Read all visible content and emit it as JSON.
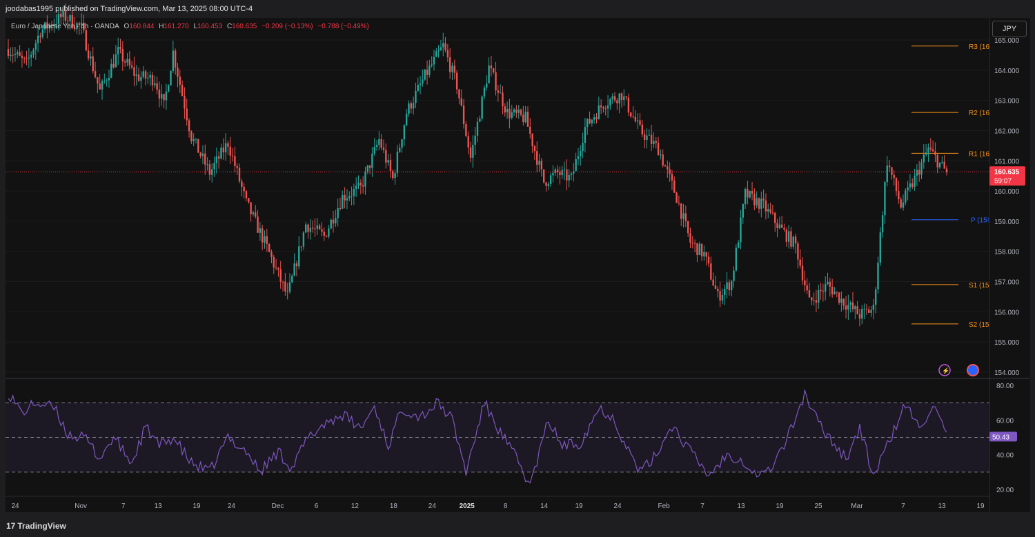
{
  "header": {
    "publisher": "joodabas1995 published on TradingView.com, Mar 13, 2025 08:00 UTC-4"
  },
  "legend": {
    "symbol": "Euro / Japanese Yen · 4h · OANDA",
    "open_k": "O",
    "open": "160.844",
    "high_k": "H",
    "high": "161.270",
    "low_k": "L",
    "low": "160.453",
    "close_k": "C",
    "close": "160.635",
    "change": "−0.209 (−0.13%)",
    "change2": "−0.788 (−0.49%)"
  },
  "currency_button": "JPY",
  "footer": {
    "brand": "TradingView",
    "logo_icon": "tradingview-logo-icon"
  },
  "colors": {
    "up": "#26a69a",
    "down": "#ef5350",
    "rsi": "#7e57c2",
    "pivot_resistance": "#f7931a",
    "pivot_p": "#2962ff",
    "price_label": "#f23645"
  },
  "chart_data": [
    {
      "type": "candlestick",
      "title": "Euro / Japanese Yen · 4h · OANDA",
      "ylim": [
        153.8,
        165.2
      ],
      "y_ticks": [
        "165.000",
        "164.000",
        "163.000",
        "162.000",
        "161.000",
        "160.000",
        "159.000",
        "158.000",
        "157.000",
        "156.000",
        "155.000",
        "154.000"
      ],
      "x_ticks": [
        "24",
        "Nov",
        "7",
        "13",
        "19",
        "24",
        "Dec",
        "6",
        "12",
        "18",
        "24",
        "2025",
        "8",
        "14",
        "19",
        "24",
        "Feb",
        "7",
        "13",
        "19",
        "25",
        "Mar",
        "7",
        "13",
        "19"
      ],
      "last_price": "160.635",
      "countdown": "59:07",
      "pivot_levels": [
        {
          "name": "R3",
          "label": "R3 (16",
          "value": 164.8
        },
        {
          "name": "R2",
          "label": "R2 (16",
          "value": 162.6
        },
        {
          "name": "R1",
          "label": "R1 (16",
          "value": 161.25
        },
        {
          "name": "P",
          "label": "P (15!",
          "value": 159.05
        },
        {
          "name": "S1",
          "label": "S1 (15",
          "value": 156.9
        },
        {
          "name": "S2",
          "label": "S2 (15",
          "value": 155.6
        }
      ],
      "series": [
        {
          "name": "EURJPY",
          "anchors": [
            [
              0,
              164.7
            ],
            [
              8,
              164.2
            ],
            [
              14,
              165.3
            ],
            [
              24,
              165.8
            ],
            [
              32,
              165.4
            ],
            [
              40,
              163.3
            ],
            [
              48,
              164.6
            ],
            [
              56,
              163.8
            ],
            [
              64,
              163.7
            ],
            [
              68,
              162.8
            ],
            [
              72,
              164.6
            ],
            [
              80,
              161.8
            ],
            [
              88,
              160.6
            ],
            [
              96,
              161.6
            ],
            [
              104,
              159.6
            ],
            [
              112,
              158.3
            ],
            [
              122,
              156.5
            ],
            [
              130,
              158.9
            ],
            [
              138,
              158.5
            ],
            [
              146,
              159.8
            ],
            [
              154,
              160.1
            ],
            [
              162,
              161.7
            ],
            [
              168,
              160.4
            ],
            [
              174,
              162.6
            ],
            [
              182,
              163.8
            ],
            [
              190,
              164.8
            ],
            [
              196,
              163.5
            ],
            [
              202,
              161.1
            ],
            [
              210,
              164.1
            ],
            [
              218,
              162.6
            ],
            [
              226,
              162.4
            ],
            [
              234,
              160.3
            ],
            [
              240,
              160.6
            ],
            [
              246,
              160.4
            ],
            [
              252,
              162.1
            ],
            [
              260,
              162.9
            ],
            [
              268,
              163.2
            ],
            [
              276,
              162.0
            ],
            [
              284,
              161.4
            ],
            [
              292,
              159.8
            ],
            [
              298,
              158.3
            ],
            [
              304,
              157.9
            ],
            [
              310,
              156.5
            ],
            [
              316,
              157.0
            ],
            [
              322,
              159.9
            ],
            [
              330,
              159.5
            ],
            [
              338,
              158.7
            ],
            [
              344,
              158.2
            ],
            [
              350,
              156.3
            ],
            [
              358,
              156.9
            ],
            [
              364,
              156.4
            ],
            [
              372,
              155.9
            ],
            [
              378,
              156.1
            ],
            [
              384,
              161.0
            ],
            [
              390,
              159.5
            ],
            [
              396,
              160.4
            ],
            [
              402,
              161.4
            ],
            [
              410,
              160.6
            ]
          ]
        }
      ]
    },
    {
      "type": "line",
      "title": "RSI",
      "ylim": [
        15,
        85
      ],
      "y_ticks": [
        "80.00",
        "60.00",
        "40.00",
        "20.00"
      ],
      "bands": [
        70,
        50,
        30
      ],
      "last_value": "50.43",
      "series": [
        {
          "name": "RSI",
          "anchors": [
            [
              0,
              76
            ],
            [
              6,
              64
            ],
            [
              12,
              70
            ],
            [
              20,
              67
            ],
            [
              26,
              52
            ],
            [
              34,
              49
            ],
            [
              40,
              38
            ],
            [
              46,
              50
            ],
            [
              54,
              35
            ],
            [
              60,
              56
            ],
            [
              66,
              45
            ],
            [
              72,
              50
            ],
            [
              80,
              35
            ],
            [
              88,
              30
            ],
            [
              96,
              50
            ],
            [
              104,
              42
            ],
            [
              110,
              30
            ],
            [
              118,
              42
            ],
            [
              124,
              32
            ],
            [
              130,
              48
            ],
            [
              138,
              58
            ],
            [
              146,
              63
            ],
            [
              154,
              55
            ],
            [
              160,
              68
            ],
            [
              166,
              45
            ],
            [
              172,
              67
            ],
            [
              180,
              62
            ],
            [
              188,
              70
            ],
            [
              194,
              60
            ],
            [
              200,
              30
            ],
            [
              208,
              70
            ],
            [
              214,
              55
            ],
            [
              222,
              38
            ],
            [
              228,
              22
            ],
            [
              236,
              60
            ],
            [
              242,
              45
            ],
            [
              250,
              47
            ],
            [
              258,
              67
            ],
            [
              264,
              62
            ],
            [
              270,
              45
            ],
            [
              276,
              30
            ],
            [
              282,
              38
            ],
            [
              290,
              57
            ],
            [
              298,
              42
            ],
            [
              306,
              28
            ],
            [
              314,
              40
            ],
            [
              320,
              38
            ],
            [
              326,
              29
            ],
            [
              332,
              30
            ],
            [
              340,
              48
            ],
            [
              348,
              75
            ],
            [
              354,
              58
            ],
            [
              360,
              48
            ],
            [
              366,
              38
            ],
            [
              372,
              55
            ],
            [
              378,
              28
            ],
            [
              384,
              45
            ],
            [
              392,
              69
            ],
            [
              398,
              55
            ],
            [
              404,
              69
            ],
            [
              410,
              50
            ]
          ]
        }
      ]
    }
  ]
}
